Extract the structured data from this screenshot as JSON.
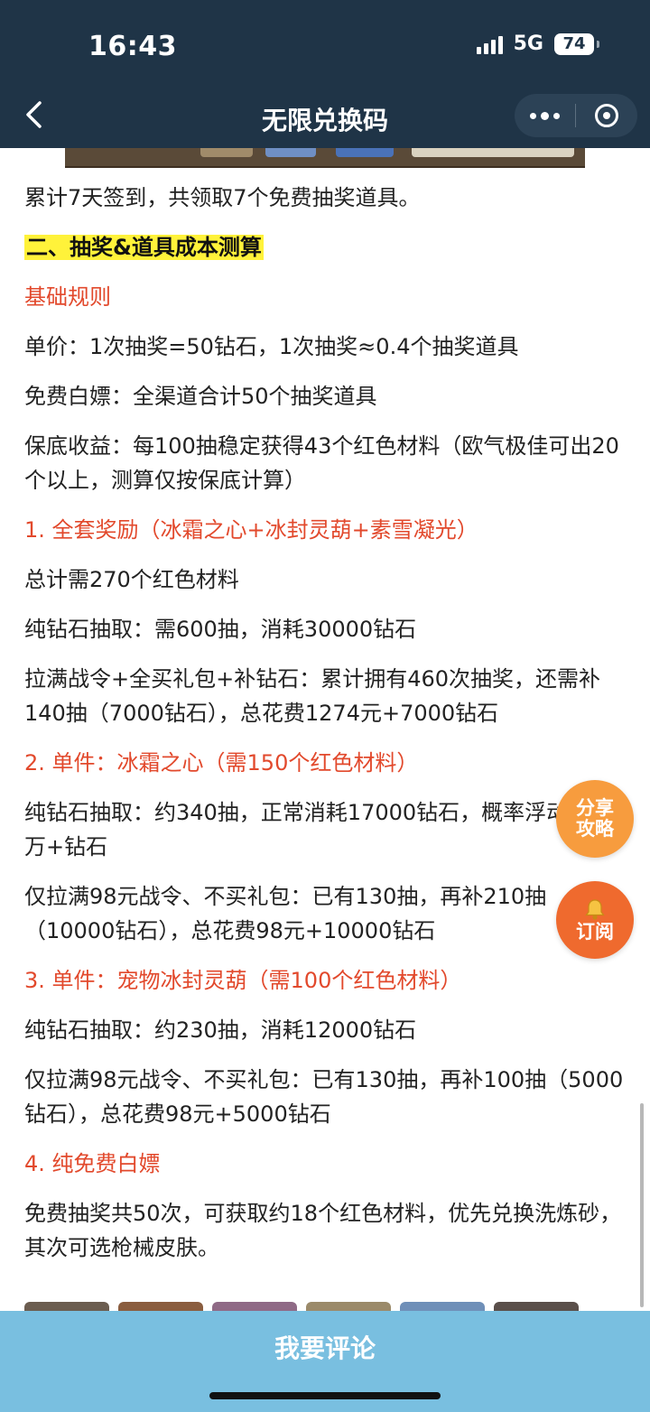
{
  "status_bar": {
    "time": "16:43",
    "network": "5G",
    "battery": "74"
  },
  "nav": {
    "title": "无限兑换码"
  },
  "article": {
    "paragraphs": [
      {
        "text": "累计7天签到，共领取7个免费抽奖道具。",
        "style": "normal"
      },
      {
        "text": "二、抽奖&道具成本测算",
        "style": "highlight"
      },
      {
        "text": "基础规则",
        "style": "red"
      },
      {
        "text": "单价：1次抽奖=50钻石，1次抽奖≈0.4个抽奖道具",
        "style": "normal"
      },
      {
        "text": "免费白嫖：全渠道合计50个抽奖道具",
        "style": "normal"
      },
      {
        "text": "保底收益：每100抽稳定获得43个红色材料（欧气极佳可出20个以上，测算仅按保底计算）",
        "style": "normal"
      },
      {
        "text": "1. 全套奖励（冰霜之心+冰封灵葫+素雪凝光）",
        "style": "red"
      },
      {
        "text": "总计需270个红色材料",
        "style": "normal"
      },
      {
        "text": "纯钻石抽取：需600抽，消耗30000钻石",
        "style": "normal"
      },
      {
        "text": "拉满战令+全买礼包+补钻石：累计拥有460次抽奖，还需补140抽（7000钻石），总花费1274元+7000钻石",
        "style": "normal"
      },
      {
        "text": "2. 单件：冰霜之心（需150个红色材料）",
        "style": "red"
      },
      {
        "text": "纯钻石抽取：约340抽，正常消耗17000钻石，概率浮动或需2万+钻石",
        "style": "normal"
      },
      {
        "text": "仅拉满98元战令、不买礼包：已有130抽，再补210抽（10000钻石），总花费98元+10000钻石",
        "style": "normal"
      },
      {
        "text": "3. 单件：宠物冰封灵葫（需100个红色材料）",
        "style": "red"
      },
      {
        "text": "纯钻石抽取：约230抽，消耗12000钻石",
        "style": "normal"
      },
      {
        "text": "仅拉满98元战令、不买礼包：已有130抽，再补100抽（5000钻石），总花费98元+5000钻石",
        "style": "normal"
      },
      {
        "text": "4. 纯免费白嫖",
        "style": "red"
      },
      {
        "text": "免费抽奖共50次，可获取约18个红色材料，优先兑换洗炼砂，其次可选枪械皮肤。",
        "style": "normal"
      }
    ]
  },
  "floating": {
    "share_line1": "分享",
    "share_line2": "攻略",
    "subscribe": "订阅"
  },
  "bottom": {
    "comment_label": "我要评论"
  },
  "colors": {
    "header_bg": "#1f3447",
    "accent_red": "#e2492c",
    "highlight": "#fff23a",
    "bottom_bar": "#79bfe0",
    "fab_orange": "#f48a3a"
  }
}
